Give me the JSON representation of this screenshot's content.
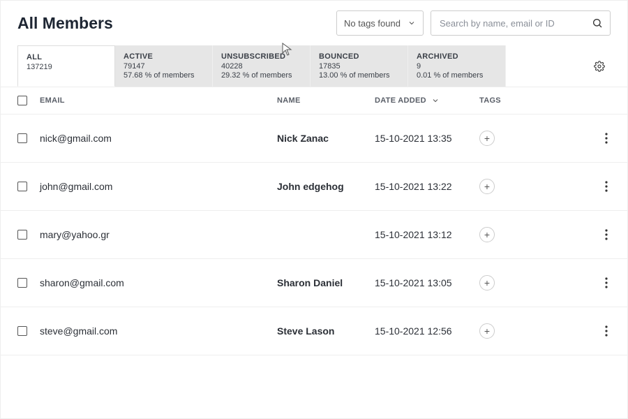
{
  "title": "All Members",
  "tags_dropdown": {
    "label": "No tags found"
  },
  "search": {
    "placeholder": "Search by name, email or ID"
  },
  "tabs": [
    {
      "label": "ALL",
      "count": "137219",
      "pct": ""
    },
    {
      "label": "ACTIVE",
      "count": "79147",
      "pct": "57.68 % of members"
    },
    {
      "label": "UNSUBSCRIBED",
      "count": "40228",
      "pct": "29.32 % of members"
    },
    {
      "label": "BOUNCED",
      "count": "17835",
      "pct": "13.00 % of members"
    },
    {
      "label": "ARCHIVED",
      "count": "9",
      "pct": "0.01 % of members"
    }
  ],
  "columns": {
    "email": "EMAIL",
    "name": "NAME",
    "date": "DATE ADDED",
    "tags": "TAGS"
  },
  "rows": [
    {
      "email": "nick@gmail.com",
      "name": "Nick Zanac",
      "date": "15-10-2021 13:35"
    },
    {
      "email": "john@gmail.com",
      "name": "John edgehog",
      "date": "15-10-2021 13:22"
    },
    {
      "email": "mary@yahoo.gr",
      "name": "",
      "date": "15-10-2021 13:12"
    },
    {
      "email": "sharon@gmail.com",
      "name": "Sharon Daniel",
      "date": "15-10-2021 13:05"
    },
    {
      "email": "steve@gmail.com",
      "name": "Steve Lason",
      "date": "15-10-2021 12:56"
    }
  ]
}
